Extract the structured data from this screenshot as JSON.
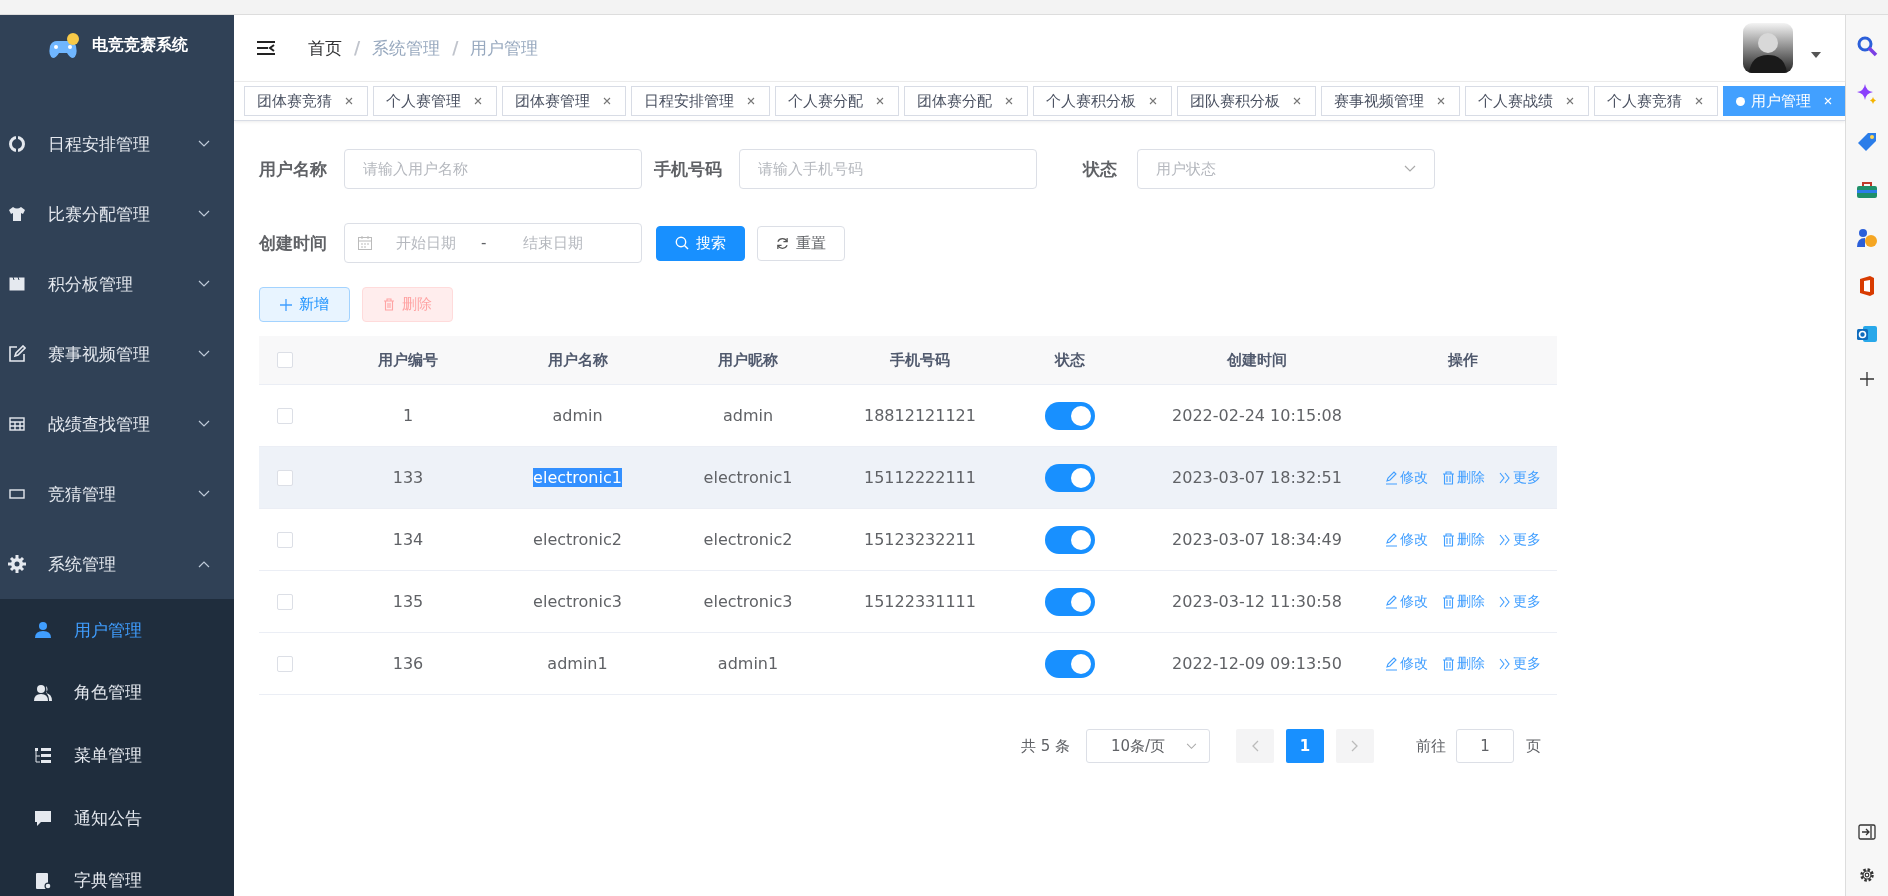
{
  "sidebar": {
    "logo_title": "电竞竞赛系统",
    "items": [
      {
        "label": "日程安排管理",
        "kind": "target",
        "expanded": false
      },
      {
        "label": "比赛分配管理",
        "kind": "shirt",
        "expanded": false
      },
      {
        "label": "积分板管理",
        "kind": "board",
        "expanded": false
      },
      {
        "label": "赛事视频管理",
        "kind": "edit",
        "expanded": false
      },
      {
        "label": "战绩查找管理",
        "kind": "table",
        "expanded": false
      },
      {
        "label": "竞猜管理",
        "kind": "input",
        "expanded": false
      },
      {
        "label": "系统管理",
        "kind": "gear",
        "expanded": true,
        "children": [
          {
            "label": "用户管理",
            "kind": "user",
            "selected": true
          },
          {
            "label": "角色管理",
            "kind": "users",
            "selected": false
          },
          {
            "label": "菜单管理",
            "kind": "tree",
            "selected": false
          },
          {
            "label": "通知公告",
            "kind": "message",
            "selected": false
          },
          {
            "label": "字典管理",
            "kind": "dict",
            "selected": false
          }
        ]
      }
    ]
  },
  "breadcrumb": [
    {
      "label": "首页",
      "kind": "link"
    },
    {
      "label": "/",
      "kind": "separator"
    },
    {
      "label": "系统管理",
      "kind": "crumb"
    },
    {
      "label": "/",
      "kind": "separator"
    },
    {
      "label": "用户管理",
      "kind": "crumb"
    }
  ],
  "tabs": [
    {
      "label": "团体赛竞猜",
      "selected": false
    },
    {
      "label": "个人赛管理",
      "selected": false
    },
    {
      "label": "团体赛管理",
      "selected": false
    },
    {
      "label": "日程安排管理",
      "selected": false
    },
    {
      "label": "个人赛分配",
      "selected": false
    },
    {
      "label": "团体赛分配",
      "selected": false
    },
    {
      "label": "个人赛积分板",
      "selected": false
    },
    {
      "label": "团队赛积分板",
      "selected": false
    },
    {
      "label": "赛事视频管理",
      "selected": false
    },
    {
      "label": "个人赛战绩",
      "selected": false
    },
    {
      "label": "个人赛竞猜",
      "selected": false
    },
    {
      "label": "用户管理",
      "selected": true
    }
  ],
  "filters": {
    "user_name": {
      "label": "用户名称",
      "placeholder": "请输入用户名称"
    },
    "phone": {
      "label": "手机号码",
      "placeholder": "请输入手机号码"
    },
    "status": {
      "label": "状态",
      "placeholder": "用户状态"
    },
    "created": {
      "label": "创建时间",
      "start_placeholder": "开始日期",
      "separator": "-",
      "end_placeholder": "结束日期"
    },
    "search_button": "搜索",
    "reset_button": "重置"
  },
  "toolbar": {
    "add_button": "新增",
    "delete_button": "删除",
    "delete_disabled": true
  },
  "table": {
    "select_all_checked": false,
    "columns": [
      "用户编号",
      "用户名称",
      "用户昵称",
      "手机号码",
      "状态",
      "创建时间",
      "操作"
    ],
    "rows": [
      {
        "id": "1",
        "name": "admin",
        "nickname": "admin",
        "phone": "18812121121",
        "on": true,
        "created": "2022-02-24 10:15:08",
        "checked": false,
        "hovered": false,
        "name_highlighted": false,
        "actions": []
      },
      {
        "id": "133",
        "name": "electronic1",
        "nickname": "electronic1",
        "phone": "15112222111",
        "on": true,
        "created": "2023-03-07 18:32:51",
        "checked": false,
        "hovered": true,
        "name_highlighted": true,
        "actions": [
          "修改",
          "删除",
          "更多"
        ]
      },
      {
        "id": "134",
        "name": "electronic2",
        "nickname": "electronic2",
        "phone": "15123232211",
        "on": true,
        "created": "2023-03-07 18:34:49",
        "checked": false,
        "hovered": false,
        "name_highlighted": false,
        "actions": [
          "修改",
          "删除",
          "更多"
        ]
      },
      {
        "id": "135",
        "name": "electronic3",
        "nickname": "electronic3",
        "phone": "15122331111",
        "on": true,
        "created": "2023-03-12 11:30:58",
        "checked": false,
        "hovered": false,
        "name_highlighted": false,
        "actions": [
          "修改",
          "删除",
          "更多"
        ]
      },
      {
        "id": "136",
        "name": "admin1",
        "nickname": "admin1",
        "phone": "",
        "on": true,
        "created": "2022-12-09 09:13:50",
        "checked": false,
        "hovered": false,
        "name_highlighted": false,
        "actions": [
          "修改",
          "删除",
          "更多"
        ]
      }
    ]
  },
  "pagination": {
    "total": "共 5 条",
    "page_size": "10条/页",
    "pages": [
      {
        "label": "1",
        "selected": true
      }
    ],
    "goto_label": "前往",
    "goto_value": "1",
    "goto_suffix": "页"
  }
}
